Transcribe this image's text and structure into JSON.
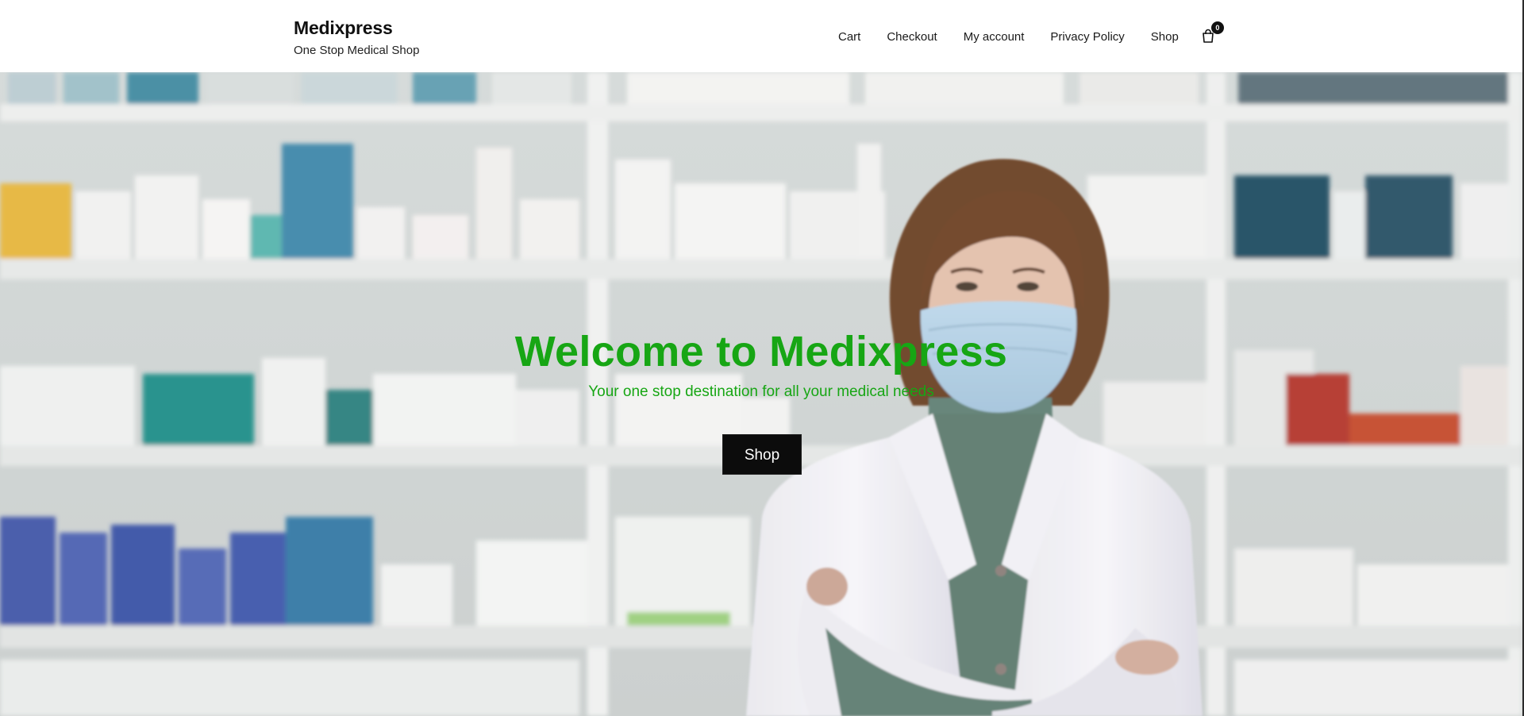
{
  "site": {
    "title": "Medixpress",
    "tagline": "One Stop Medical Shop"
  },
  "nav": {
    "items": [
      {
        "label": "Cart"
      },
      {
        "label": "Checkout"
      },
      {
        "label": "My account"
      },
      {
        "label": "Privacy Policy"
      },
      {
        "label": "Shop"
      }
    ],
    "cart_icon": "shopping-bag-icon",
    "cart_count": "0"
  },
  "hero": {
    "title": "Welcome to Medixpress",
    "subtitle": "Your one stop destination for all your medical needs",
    "button_label": "Shop",
    "image": "pharmacist-with-face-mask-in-pharmacy-photo"
  },
  "colors": {
    "accent_green": "#17a614",
    "button_bg": "#0c0c0c",
    "header_bg": "#ffffff"
  }
}
